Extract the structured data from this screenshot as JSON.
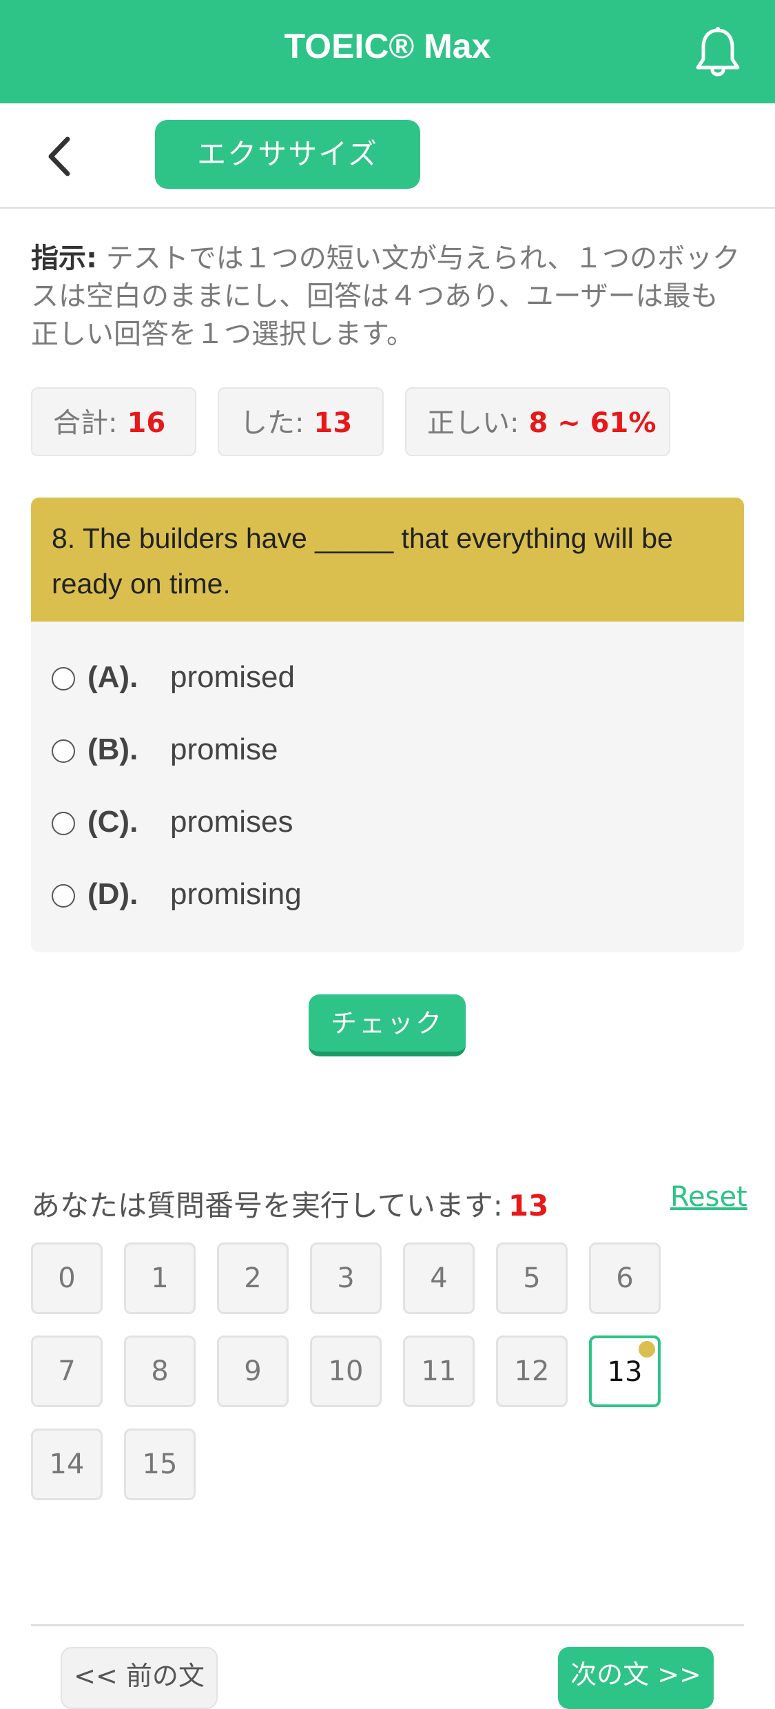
{
  "header": {
    "title": "TOEIC® Max",
    "notification_icon": "bell-icon"
  },
  "nav": {
    "back_icon": "chevron-left-icon",
    "tab_label": "エクササイズ"
  },
  "instructions": {
    "label": "指示:",
    "text": " テストでは１つの短い文が与えられ、１つのボックスは空白のままにし、回答は４つあり、ユーザーは最も正しい回答を１つ選択します。"
  },
  "stats": {
    "total_label": "合計:",
    "total_value": "16",
    "done_label": "した:",
    "done_value": "13",
    "correct_label": "正しい:",
    "correct_value": "8 ~ 61%"
  },
  "question": {
    "text": "8. The builders have _____ that everything will be ready on time.",
    "options": [
      {
        "letter": "(A).",
        "text": "promised"
      },
      {
        "letter": "(B).",
        "text": "promise"
      },
      {
        "letter": "(C).",
        "text": "promises"
      },
      {
        "letter": "(D).",
        "text": "promising"
      }
    ]
  },
  "actions": {
    "check_label": "チェック"
  },
  "progress": {
    "running_label": "あなたは質問番号を実行しています:",
    "current": "13",
    "reset_label": "Reset",
    "numbers": [
      "0",
      "1",
      "2",
      "3",
      "4",
      "5",
      "6",
      "7",
      "8",
      "9",
      "10",
      "11",
      "12",
      "13",
      "14",
      "15"
    ]
  },
  "footer": {
    "prev_label": "<< 前の文",
    "next_label": "次の文 >>"
  },
  "colors": {
    "accent": "#2ec387",
    "question_bg": "#dabf4e",
    "highlight": "#e81818"
  }
}
